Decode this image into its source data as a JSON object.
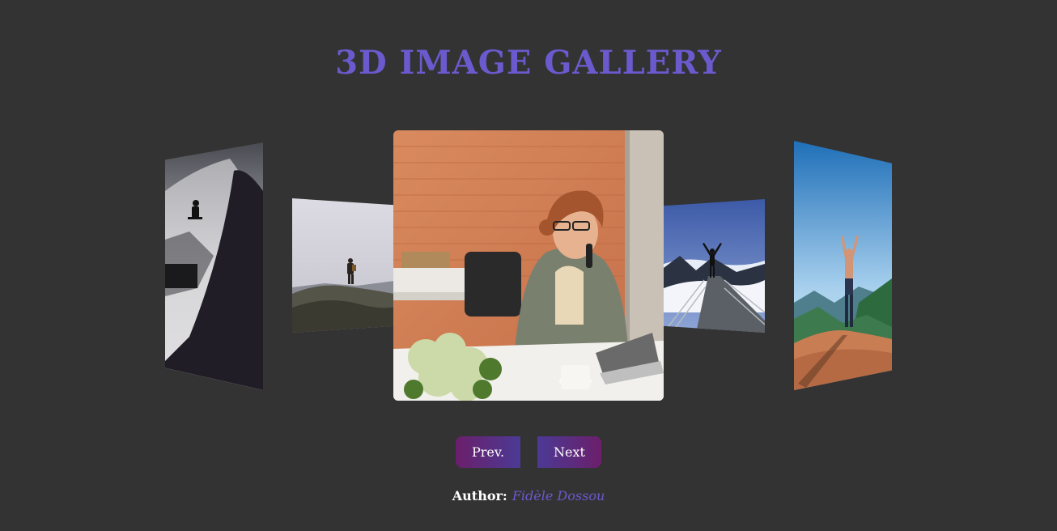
{
  "header": {
    "title": "3D IMAGE GALLERY"
  },
  "gallery": {
    "images": [
      {
        "subject": "skateboarder on wall ride (black and white)"
      },
      {
        "subject": "hiker standing on rocky summit"
      },
      {
        "subject": "woman on phone at laptop in office"
      },
      {
        "subject": "person with raised arms on mountain walkway above clouds"
      },
      {
        "subject": "shirtless man with raised arms on cliff edge"
      }
    ]
  },
  "controls": {
    "prev_label": "Prev.",
    "next_label": "Next"
  },
  "footer": {
    "author_label": "Author:",
    "author_name": "Fidèle Dossou"
  },
  "colors": {
    "background": "#333333",
    "accent": "#6a5acd",
    "button_purple": "#4b3a94",
    "button_magenta": "#6b1f6b"
  }
}
